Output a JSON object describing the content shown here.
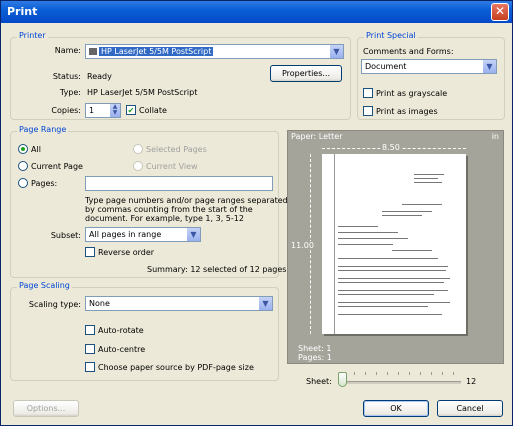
{
  "window": {
    "title": "Print",
    "close_glyph": "✕"
  },
  "printer": {
    "group_label": "Printer",
    "name_label": "Name:",
    "name_value": "HP LaserJet 5/5M PostScript",
    "properties_label": "Properties...",
    "status_label": "Status:",
    "status_value": "Ready",
    "type_label": "Type:",
    "type_value": "HP LaserJet 5/5M PostScript",
    "copies_label": "Copies:",
    "copies_value": "1",
    "collate_label": "Collate",
    "collate_checked": true
  },
  "print_special": {
    "group_label": "Print Special",
    "comments_label": "Comments and Forms:",
    "comments_value": "Document",
    "grayscale_label": "Print as grayscale",
    "images_label": "Print as images"
  },
  "page_range": {
    "group_label": "Page Range",
    "all_label": "All",
    "current_page_label": "Current Page",
    "pages_label": "Pages:",
    "selected_pages_label": "Selected Pages",
    "current_view_label": "Current View",
    "pages_value": "",
    "help_text_1": "Type page numbers and/or page ranges separated",
    "help_text_2": "by commas counting from the start of the",
    "help_text_3": "document. For example, type 1, 3, 5-12",
    "subset_label": "Subset:",
    "subset_value": "All pages in range",
    "reverse_label": "Reverse order",
    "summary": "Summary: 12 selected of 12 pages"
  },
  "page_scaling": {
    "group_label": "Page Scaling",
    "scaling_type_label": "Scaling type:",
    "scaling_type_value": "None",
    "auto_rotate_label": "Auto-rotate",
    "auto_centre_label": "Auto-centre",
    "paper_source_label": "Choose paper source by PDF-page size"
  },
  "preview": {
    "paper_label": "Paper: Letter",
    "unit_label": "in",
    "width_label": "8.50",
    "height_label": "11.00",
    "sheet_info": "Sheet: 1",
    "page_info": "Pages: 1"
  },
  "sheet": {
    "label": "Sheet:",
    "max": "12",
    "position_fraction": 0.0
  },
  "buttons": {
    "options": "Options...",
    "ok": "OK",
    "cancel": "Cancel"
  },
  "colors": {
    "title_bar": "#0a5fd6",
    "group_title": "#0046d5",
    "selection": "#316ac5",
    "preview_bg": "#a5a49a"
  }
}
